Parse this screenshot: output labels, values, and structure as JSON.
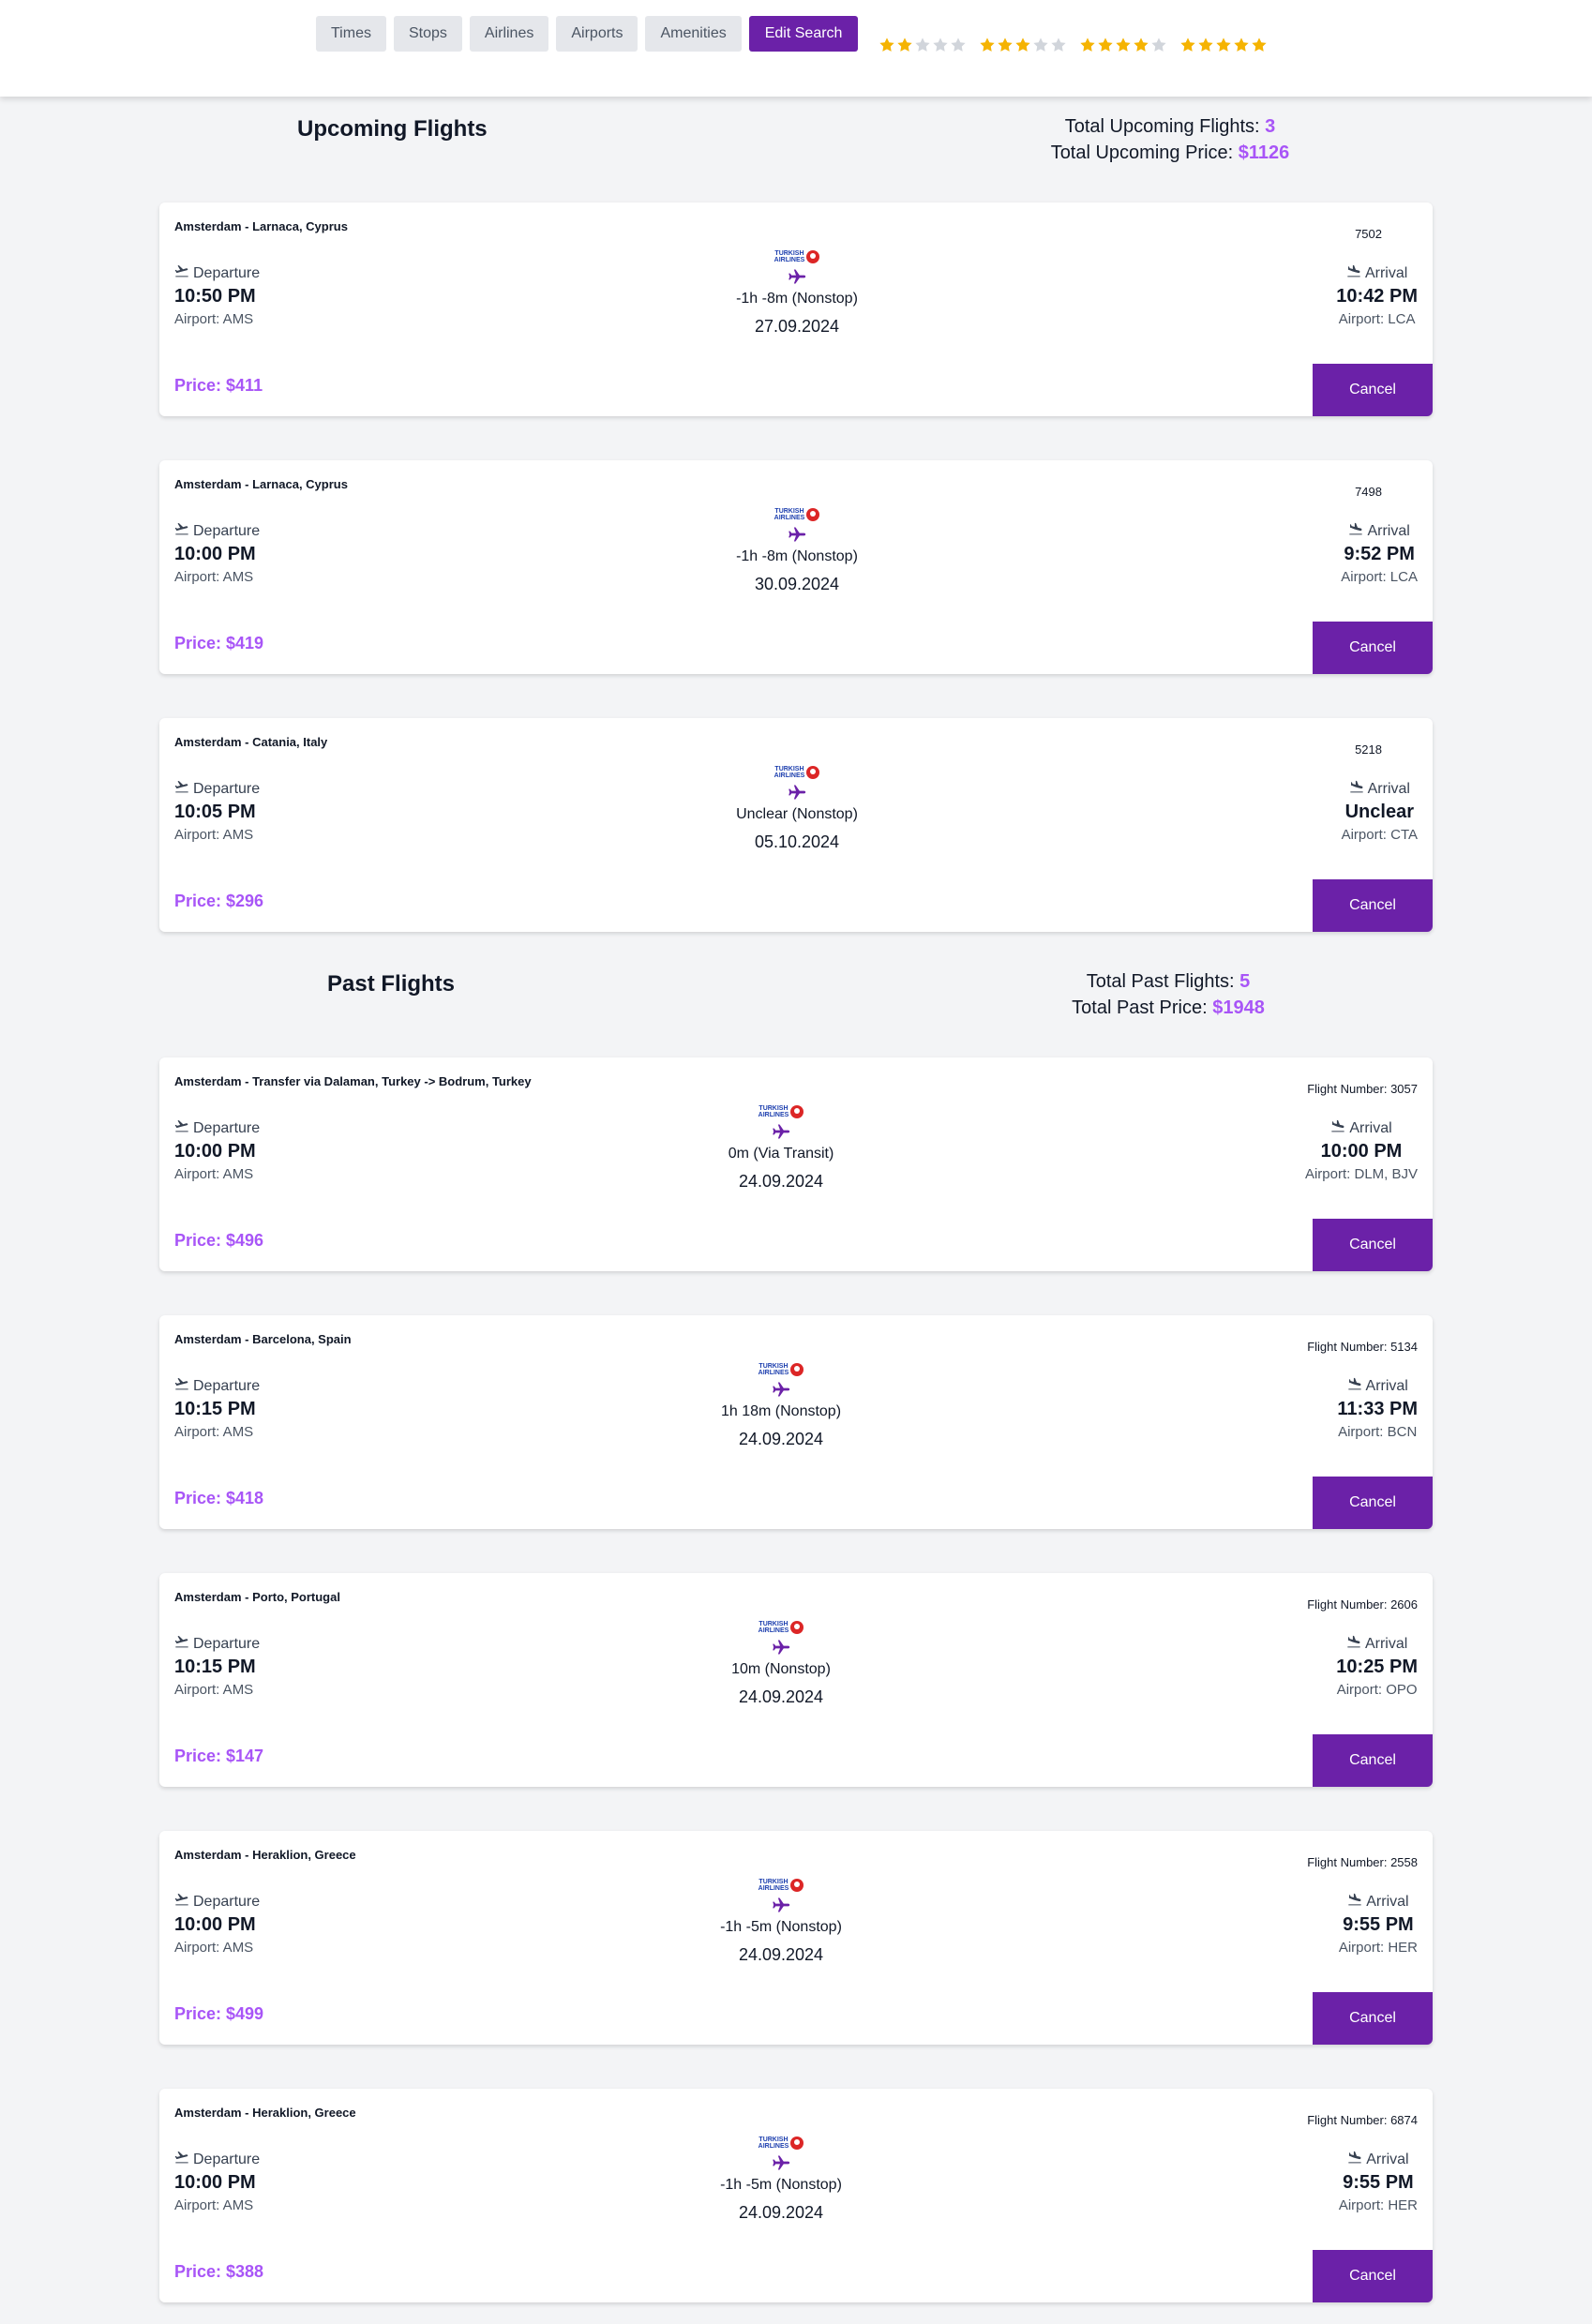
{
  "filters": {
    "buttons": [
      "Times",
      "Stops",
      "Airlines",
      "Airports",
      "Amenities"
    ],
    "edit_label": "Edit Search"
  },
  "ratings": [
    {
      "filled": 2,
      "total": 5
    },
    {
      "filled": 3,
      "total": 5
    },
    {
      "filled": 4,
      "total": 5
    },
    {
      "filled": 5,
      "total": 5
    }
  ],
  "colors": {
    "accent": "#6b21a8",
    "highlight": "#a855f7",
    "star_filled": "#f5b301",
    "star_empty": "#d1d5db",
    "background": "#f3f4f6"
  },
  "upcoming": {
    "title": "Upcoming Flights",
    "count_label": "Total Upcoming Flights:",
    "count": "3",
    "price_label": "Total Upcoming Price:",
    "price": "$1126"
  },
  "past": {
    "title": "Past Flights",
    "count_label": "Total Past Flights:",
    "count": "5",
    "price_label": "Total Past Price:",
    "price": "$1948"
  },
  "labels": {
    "departure": "Departure",
    "arrival": "Arrival",
    "cancel": "Cancel",
    "airline_line1": "TURKISH",
    "airline_line2": "AIRLINES",
    "icons": [
      "takeoff-icon",
      "landing-icon",
      "plane-icon",
      "star-icon"
    ]
  },
  "upcoming_flights": [
    {
      "route": "Amsterdam - Larnaca, Cyprus",
      "flight_number": "7502",
      "dep_time": "10:50 PM",
      "dep_airport": "Airport: AMS",
      "arr_time": "10:42 PM",
      "arr_airport": "Airport: LCA",
      "duration": "-1h -8m (Nonstop)",
      "date": "27.09.2024",
      "price": "Price: $411"
    },
    {
      "route": "Amsterdam - Larnaca, Cyprus",
      "flight_number": "7498",
      "dep_time": "10:00 PM",
      "dep_airport": "Airport: AMS",
      "arr_time": "9:52 PM",
      "arr_airport": "Airport: LCA",
      "duration": "-1h -8m (Nonstop)",
      "date": "30.09.2024",
      "price": "Price: $419"
    },
    {
      "route": "Amsterdam - Catania, Italy",
      "flight_number": "5218",
      "dep_time": "10:05 PM",
      "dep_airport": "Airport: AMS",
      "arr_time": "Unclear",
      "arr_airport": "Airport: CTA",
      "duration": "Unclear (Nonstop)",
      "date": "05.10.2024",
      "price": "Price: $296"
    }
  ],
  "past_flights": [
    {
      "route": "Amsterdam - Transfer via Dalaman, Turkey -> Bodrum, Turkey",
      "flight_number": "Flight Number: 3057",
      "dep_time": "10:00 PM",
      "dep_airport": "Airport: AMS",
      "arr_time": "10:00 PM",
      "arr_airport": "Airport: DLM, BJV",
      "duration": "0m (Via Transit)",
      "date": "24.09.2024",
      "price": "Price: $496"
    },
    {
      "route": "Amsterdam - Barcelona, Spain",
      "flight_number": "Flight Number: 5134",
      "dep_time": "10:15 PM",
      "dep_airport": "Airport: AMS",
      "arr_time": "11:33 PM",
      "arr_airport": "Airport: BCN",
      "duration": "1h 18m (Nonstop)",
      "date": "24.09.2024",
      "price": "Price: $418"
    },
    {
      "route": "Amsterdam - Porto, Portugal",
      "flight_number": "Flight Number: 2606",
      "dep_time": "10:15 PM",
      "dep_airport": "Airport: AMS",
      "arr_time": "10:25 PM",
      "arr_airport": "Airport: OPO",
      "duration": "10m (Nonstop)",
      "date": "24.09.2024",
      "price": "Price: $147"
    },
    {
      "route": "Amsterdam - Heraklion, Greece",
      "flight_number": "Flight Number: 2558",
      "dep_time": "10:00 PM",
      "dep_airport": "Airport: AMS",
      "arr_time": "9:55 PM",
      "arr_airport": "Airport: HER",
      "duration": "-1h -5m (Nonstop)",
      "date": "24.09.2024",
      "price": "Price: $499"
    },
    {
      "route": "Amsterdam - Heraklion, Greece",
      "flight_number": "Flight Number: 6874",
      "dep_time": "10:00 PM",
      "dep_airport": "Airport: AMS",
      "arr_time": "9:55 PM",
      "arr_airport": "Airport: HER",
      "duration": "-1h -5m (Nonstop)",
      "date": "24.09.2024",
      "price": "Price: $388"
    }
  ]
}
